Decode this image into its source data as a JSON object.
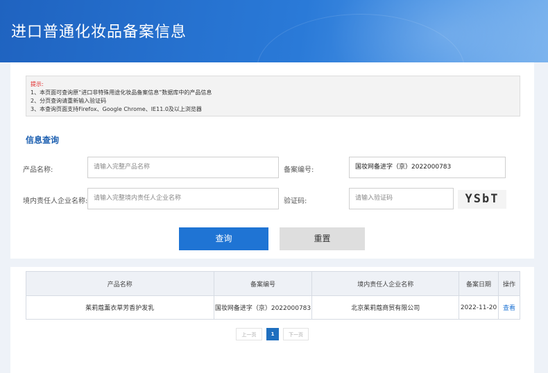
{
  "header": {
    "title": "进口普通化妆品备案信息"
  },
  "notice": {
    "title": "提示:",
    "lines": [
      "1、本页面可查询原“进口非特殊用途化妆品备案信息”数据库中的产品信息",
      "2、分页查询请重新输入验证码",
      "3、本查询页面支持Firefox、Google Chrome、IE11.0及以上浏览器"
    ]
  },
  "search": {
    "section_title": "信息查询",
    "product_name_label": "产品名称:",
    "product_name_placeholder": "请输入完整产品名称",
    "record_no_label": "备案编号:",
    "record_no_value": "国妆网备进字（京）2022000783",
    "company_label": "境内责任人企业名称:",
    "company_placeholder": "请输入完整境内责任人企业名称",
    "captcha_label": "验证码:",
    "captcha_placeholder": "请输入验证码",
    "captcha_text": "YSbT",
    "query_button": "查询",
    "reset_button": "重置"
  },
  "results": {
    "columns": [
      "产品名称",
      "备案编号",
      "境内责任人企业名称",
      "备案日期",
      "操作"
    ],
    "rows": [
      {
        "product": "茱莉蔻薰衣草芳香护发乳",
        "record_no": "国妆网备进字（京）2022000783",
        "company": "北京茱莉蔻商贸有限公司",
        "date": "2022-11-20",
        "action": "查看"
      }
    ]
  },
  "pagination": {
    "prev": "上一页",
    "current": "1",
    "next": "下一页"
  },
  "colors": {
    "accent": "#1f74d4",
    "banner": "#2a7ad8",
    "notice_title": "#e02020"
  }
}
